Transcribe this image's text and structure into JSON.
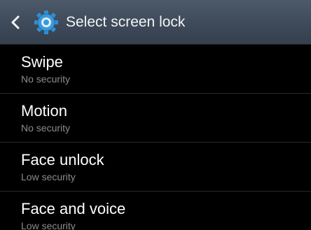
{
  "header": {
    "title": "Select screen lock",
    "back_icon": "chevron-left-icon",
    "settings_icon": "gear-icon"
  },
  "options": [
    {
      "label": "Swipe",
      "security": "No security"
    },
    {
      "label": "Motion",
      "security": "No security"
    },
    {
      "label": "Face unlock",
      "security": "Low security"
    },
    {
      "label": "Face and voice",
      "security": "Low security"
    }
  ],
  "colors": {
    "action_bar": "#3e4a59",
    "background": "#000000",
    "gear_accent": "#3a9ad9"
  }
}
